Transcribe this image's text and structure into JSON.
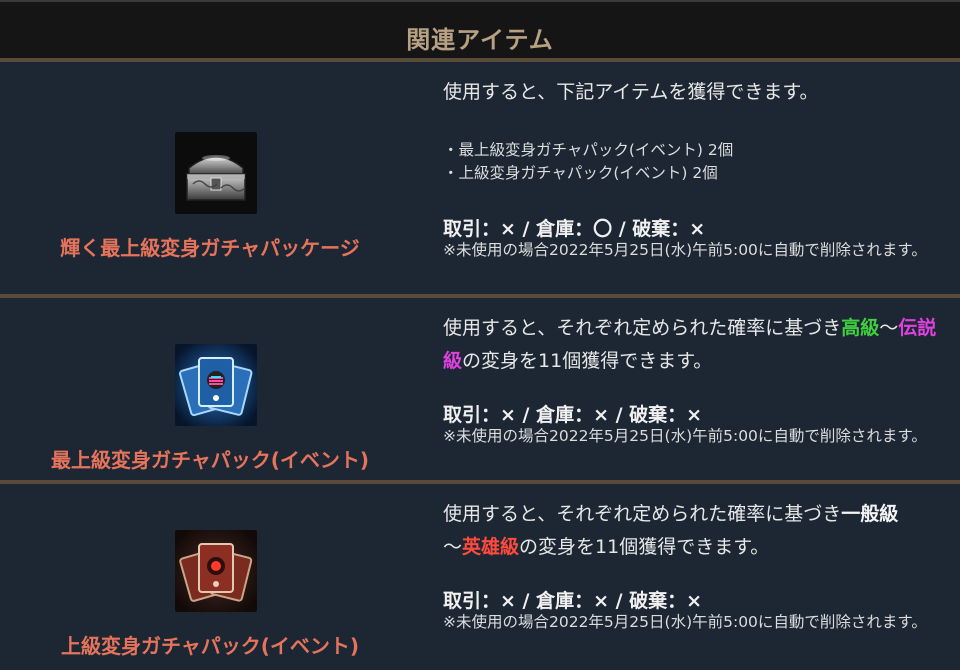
{
  "header": {
    "title": "関連アイテム"
  },
  "items": [
    {
      "name": "輝く最上級変身ガチャパッケージ",
      "icon": "treasure-chest-icon",
      "desc": "使用すると、下記アイテムを獲得できます。",
      "list": [
        "・最上級変身ガチャパック(イベント) 2個",
        "・上級変身ガチャパック(イベント) 2個"
      ],
      "trade": "取引：× / 倉庫：〇 / 破棄：×",
      "note": "※未使用の場合2022年5月25日(水)午前5:00に自動で削除されます。"
    },
    {
      "name": "最上級変身ガチャパック(イベント)",
      "icon": "blue-card-pack-icon",
      "desc_part1": "使用すると、それぞれ定められた確率に基づき",
      "desc_hl1": "高級",
      "desc_part2": "～",
      "desc_hl2": "伝説級",
      "desc_part3": "の変身を11個獲得できます。",
      "trade": "取引：× / 倉庫：× / 破棄：×",
      "note": "※未使用の場合2022年5月25日(水)午前5:00に自動で削除されます。"
    },
    {
      "name": "上級変身ガチャパック(イベント)",
      "icon": "red-card-pack-icon",
      "desc_part1": "使用すると、それぞれ定められた確率に基づき",
      "desc_hl1": "一般級",
      "desc_part2": "～",
      "desc_hl2": "英雄級",
      "desc_part3": "の変身を11個獲得できます。",
      "trade": "取引：× / 倉庫：× / 破棄：×",
      "note": "※未使用の場合2022年5月25日(水)午前5:00に自動で削除されます。"
    }
  ],
  "colors": {
    "background": "#1c2733",
    "header_bg": "#151515",
    "title": "#b7a182",
    "item_name": "#e6735b",
    "divider": "#5a4a3a",
    "green": "#3fcf3f",
    "magenta": "#e040e0",
    "red": "#ff4a3c"
  }
}
